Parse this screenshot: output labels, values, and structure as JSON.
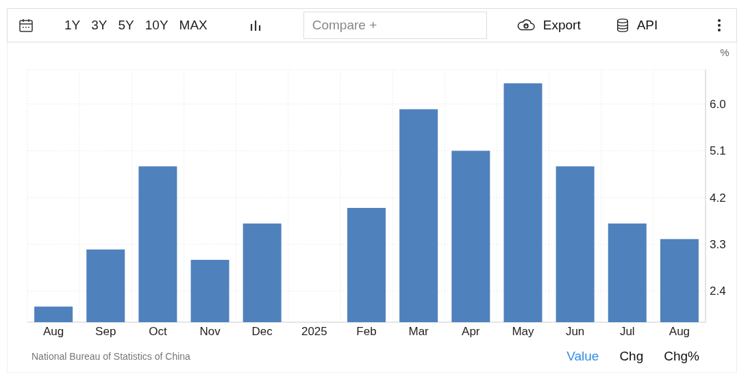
{
  "toolbar": {
    "ranges": [
      {
        "label": "1Y"
      },
      {
        "label": "3Y"
      },
      {
        "label": "5Y"
      },
      {
        "label": "10Y"
      },
      {
        "label": "MAX"
      }
    ],
    "compare": {
      "placeholder": "Compare +"
    },
    "export": {
      "label": "Export"
    },
    "api": {
      "label": "API"
    }
  },
  "chart": {
    "unit": "%",
    "chart_data": {
      "type": "bar",
      "categories": [
        "Aug",
        "Sep",
        "Oct",
        "Nov",
        "Dec",
        "2025",
        "Feb",
        "Mar",
        "Apr",
        "May",
        "Jun",
        "Jul",
        "Aug"
      ],
      "series": [
        {
          "color": "#4f81bd",
          "values": [
            2.1,
            3.2,
            4.8,
            3.0,
            3.7,
            null,
            4.0,
            5.9,
            5.1,
            6.4,
            4.8,
            3.7,
            3.4
          ]
        }
      ],
      "ylim": [
        1.8,
        6.66
      ],
      "yticks": [
        {
          "value": 2.4,
          "label": "2.4"
        },
        {
          "value": 3.3,
          "label": "3.3"
        },
        {
          "value": 4.2,
          "label": "4.2"
        },
        {
          "value": 5.1,
          "label": "5.1"
        },
        {
          "value": 6.0,
          "label": "6.0"
        }
      ],
      "grid": true
    }
  },
  "source": "National Bureau of Statistics of China",
  "views": [
    {
      "label": "Value",
      "selected": true
    },
    {
      "label": "Chg",
      "selected": false
    },
    {
      "label": "Chg%",
      "selected": false
    }
  ]
}
